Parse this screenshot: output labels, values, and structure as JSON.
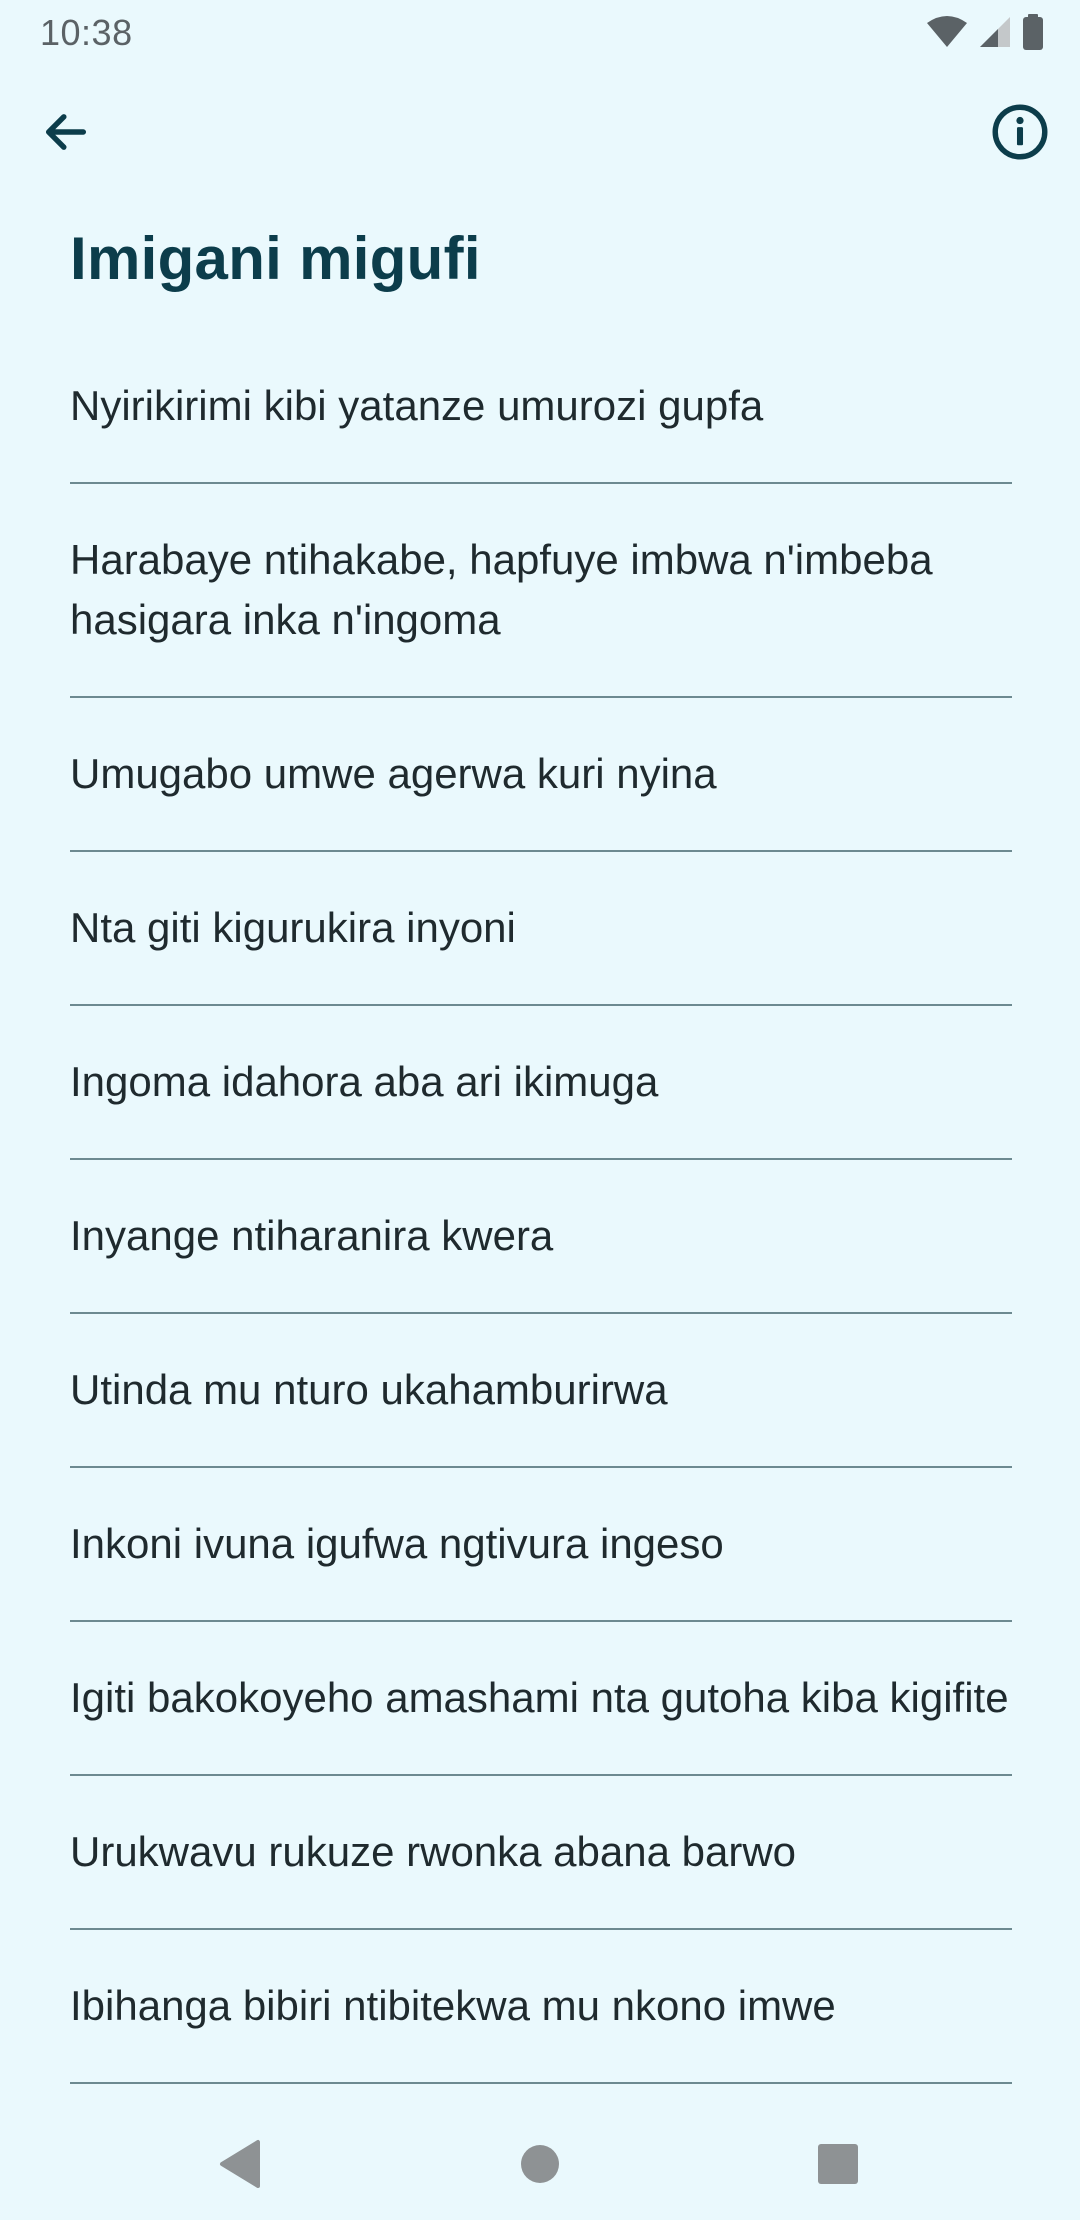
{
  "status_bar": {
    "time": "10:38",
    "icons": [
      "wifi-icon",
      "signal-icon",
      "battery-icon"
    ]
  },
  "app_bar": {
    "back_icon": "arrow-left-icon",
    "info_icon": "info-icon"
  },
  "page": {
    "title": "Imigani migufi"
  },
  "proverbs": [
    "Nyirikirimi kibi yatanze umurozi gupfa",
    "Harabaye ntihakabe, hapfuye imbwa n'imbeba hasigara inka n'ingoma",
    "Umugabo umwe agerwa kuri nyina",
    "Nta giti kigurukira inyoni",
    "Ingoma idahora aba ari ikimuga",
    "Inyange ntiharanira kwera",
    "Utinda mu nturo ukahamburirwa",
    "Inkoni ivuna igufwa ngtivura ingeso",
    "Igiti bakokoyeho amashami nta gutoha kiba kigifite",
    "Urukwavu rukuze rwonka abana barwo",
    "Ibihanga bibiri ntibitekwa mu nkono imwe"
  ],
  "nav_bar": {
    "icons": [
      "nav-back-icon",
      "nav-home-icon",
      "nav-recents-icon"
    ]
  },
  "colors": {
    "background": "#eaf9fd",
    "title": "#0c3d4b",
    "divider": "#6d8a91",
    "icon": "#0c3d4b",
    "nav_icon": "#8e9294"
  }
}
